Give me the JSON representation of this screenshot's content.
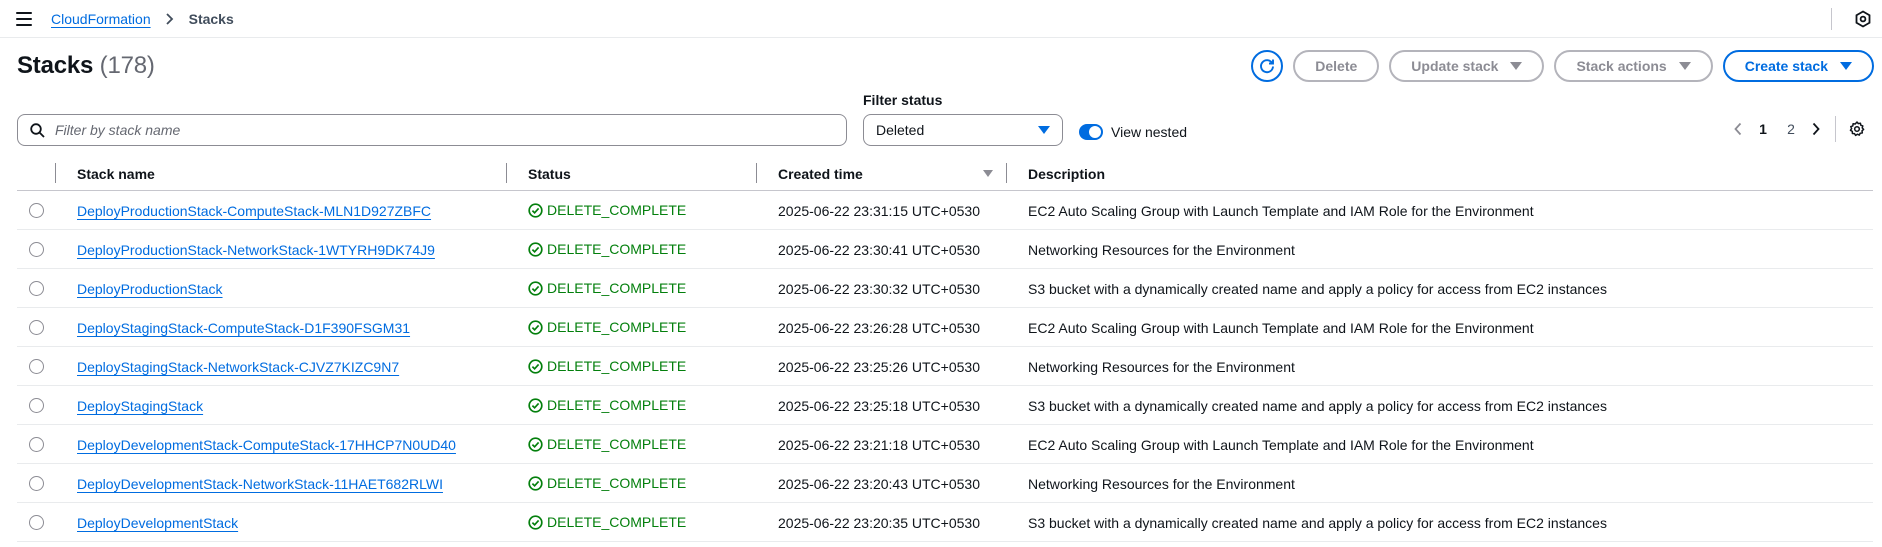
{
  "breadcrumb": {
    "root": "CloudFormation",
    "current": "Stacks"
  },
  "header": {
    "title": "Stacks",
    "count": "(178)",
    "buttons": {
      "delete": "Delete",
      "update_stack": "Update stack",
      "stack_actions": "Stack actions",
      "create_stack": "Create stack"
    }
  },
  "filters": {
    "search_placeholder": "Filter by stack name",
    "status_label": "Filter status",
    "status_value": "Deleted",
    "view_nested_label": "View nested",
    "view_nested_on": true
  },
  "pagination": {
    "pages": [
      "1",
      "2"
    ],
    "current": "1"
  },
  "table": {
    "columns": {
      "name": "Stack name",
      "status": "Status",
      "created": "Created time",
      "description": "Description"
    },
    "rows": [
      {
        "name": "DeployProductionStack-ComputeStack-MLN1D927ZBFC",
        "status": "DELETE_COMPLETE",
        "created": "2025-06-22 23:31:15 UTC+0530",
        "description": "EC2 Auto Scaling Group with Launch Template and IAM Role for the Environment"
      },
      {
        "name": "DeployProductionStack-NetworkStack-1WTYRH9DK74J9",
        "status": "DELETE_COMPLETE",
        "created": "2025-06-22 23:30:41 UTC+0530",
        "description": "Networking Resources for the Environment"
      },
      {
        "name": "DeployProductionStack",
        "status": "DELETE_COMPLETE",
        "created": "2025-06-22 23:30:32 UTC+0530",
        "description": "S3 bucket with a dynamically created name and apply a policy for access from EC2 instances"
      },
      {
        "name": "DeployStagingStack-ComputeStack-D1F390FSGM31",
        "status": "DELETE_COMPLETE",
        "created": "2025-06-22 23:26:28 UTC+0530",
        "description": "EC2 Auto Scaling Group with Launch Template and IAM Role for the Environment"
      },
      {
        "name": "DeployStagingStack-NetworkStack-CJVZ7KIZC9N7",
        "status": "DELETE_COMPLETE",
        "created": "2025-06-22 23:25:26 UTC+0530",
        "description": "Networking Resources for the Environment"
      },
      {
        "name": "DeployStagingStack",
        "status": "DELETE_COMPLETE",
        "created": "2025-06-22 23:25:18 UTC+0530",
        "description": "S3 bucket with a dynamically created name and apply a policy for access from EC2 instances"
      },
      {
        "name": "DeployDevelopmentStack-ComputeStack-17HHCP7N0UD40",
        "status": "DELETE_COMPLETE",
        "created": "2025-06-22 23:21:18 UTC+0530",
        "description": "EC2 Auto Scaling Group with Launch Template and IAM Role for the Environment"
      },
      {
        "name": "DeployDevelopmentStack-NetworkStack-11HAET682RLWI",
        "status": "DELETE_COMPLETE",
        "created": "2025-06-22 23:20:43 UTC+0530",
        "description": "Networking Resources for the Environment"
      },
      {
        "name": "DeployDevelopmentStack",
        "status": "DELETE_COMPLETE",
        "created": "2025-06-22 23:20:35 UTC+0530",
        "description": "S3 bucket with a dynamically created name and apply a policy for access from EC2 instances"
      }
    ]
  },
  "colors": {
    "link": "#006ce0",
    "success": "#037f0c",
    "text": "#0f141a",
    "disabled": "#8c8c94"
  },
  "icons": {
    "menu": "hamburger-menu-icon",
    "breadcrumb_separator": "chevron-right-icon",
    "help": "help-hexagon-icon",
    "refresh": "refresh-icon",
    "search": "search-icon",
    "status": "success-check-circle-icon",
    "settings": "gear-icon"
  }
}
